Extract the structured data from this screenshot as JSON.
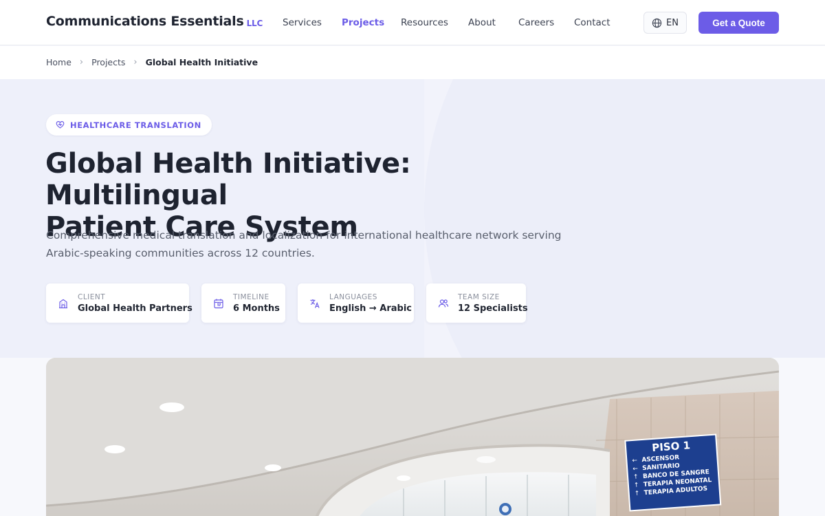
{
  "header": {
    "brand": "Communications Essentials",
    "brand_suffix": "LLC",
    "nav": [
      "Services",
      "Projects",
      "Resources",
      "About",
      "Careers",
      "Contact"
    ],
    "nav_active": "Projects",
    "language": "EN",
    "cta": "Get a Quote"
  },
  "breadcrumb": [
    "Home",
    "Projects",
    "Global Health Initiative"
  ],
  "hero": {
    "tag": "HEALTHCARE TRANSLATION",
    "title_line1": "Global Health Initiative: Multilingual",
    "title_line2": "Patient Care System",
    "subtitle_line1": "Comprehensive medical translation and localization for international healthcare network serving",
    "subtitle_line2": "Arabic-speaking communities across 12 countries.",
    "stats": [
      {
        "label": "CLIENT",
        "value": "Global Health Partners",
        "icon": "building-icon"
      },
      {
        "label": "TIMELINE",
        "value": "6 Months",
        "icon": "calendar-icon"
      },
      {
        "label": "LANGUAGES",
        "value": "English → Arabic",
        "icon": "translate-icon"
      },
      {
        "label": "TEAM SIZE",
        "value": "12 Specialists",
        "icon": "users-icon"
      }
    ]
  },
  "photo": {
    "sign_title": "PISO 1",
    "sign_items": [
      "ASCENSOR",
      "SANITARIO",
      "BANCO DE SANGRE",
      "TERAPIA NEONATAL",
      "TERAPIA ADULTOS"
    ]
  },
  "colors": {
    "accent": "#6c5ce7",
    "hero_bg": "#eef0fa",
    "text_dark": "#1e2330"
  }
}
